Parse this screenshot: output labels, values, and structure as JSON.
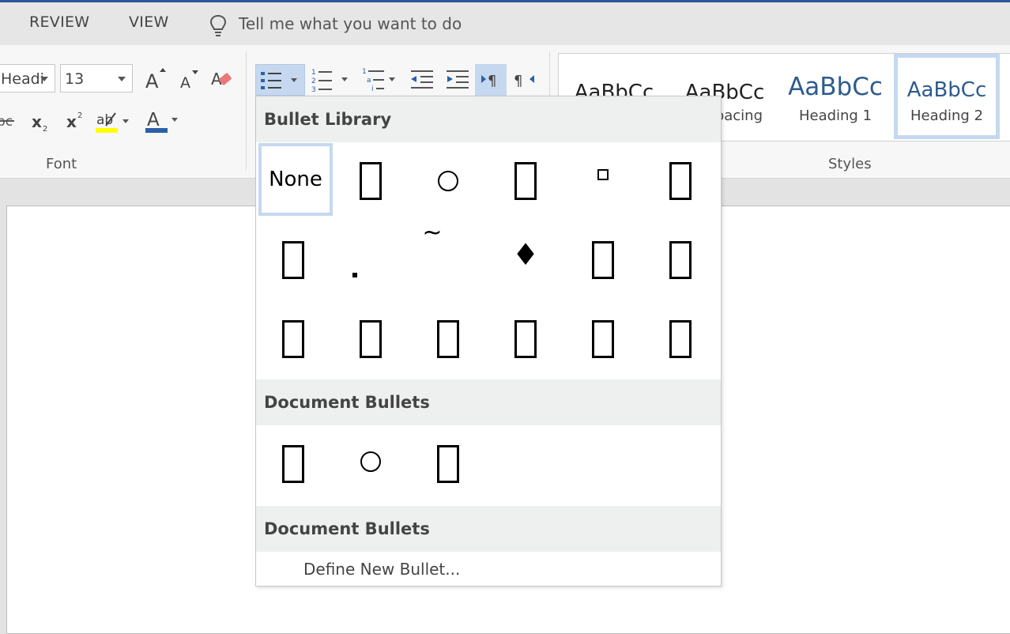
{
  "tabs": [
    "REVIEW",
    "VIEW"
  ],
  "tell_me": "Tell me what you want to do",
  "font_group": {
    "font_name": "Headi",
    "font_size": "13",
    "label": "Font"
  },
  "styles": {
    "items": [
      {
        "sample": "AaBbCc",
        "name": ""
      },
      {
        "sample": "AaBbCc",
        "name": "pacing"
      },
      {
        "sample": "AaBbCc",
        "name": "Heading 1"
      },
      {
        "sample": "AaBbCc",
        "name": "Heading 2"
      }
    ],
    "label": "Styles"
  },
  "dropdown": {
    "library_header": "Bullet Library",
    "none_label": "None",
    "document_bullets_header": "Document Bullets",
    "document_bullets_header_2": "Document Bullets",
    "define_new": "Define New Bullet...",
    "tilde": "~",
    "diamond": "♦"
  },
  "colors": {
    "accent": "#2b579a",
    "selection": "#c5d8f0",
    "header_bg": "#eef0f0",
    "heading_text": "#2e5b8f",
    "highlight_yellow": "#ffff00",
    "font_color_blue": "#2b5fa8"
  }
}
